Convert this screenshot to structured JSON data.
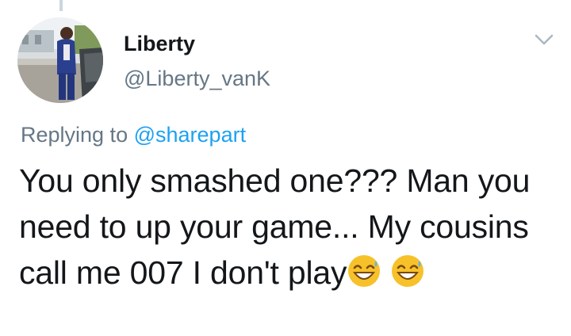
{
  "tweet": {
    "display_name": "Liberty",
    "handle": "@Liberty_vanK",
    "replying_prefix": "Replying to",
    "replying_mention": "@sharepart",
    "text_main": "You only smashed one??? Man you need to up your game... My cousins call me 007 I don't play",
    "emojis": [
      "grinning-sweat-emoji",
      "grinning-sweat-emoji"
    ]
  },
  "icons": {
    "menu": "chevron-down-icon"
  },
  "colors": {
    "text": "#14171a",
    "secondary": "#657786",
    "link": "#1da1f2",
    "emoji": "#f7c12a"
  }
}
